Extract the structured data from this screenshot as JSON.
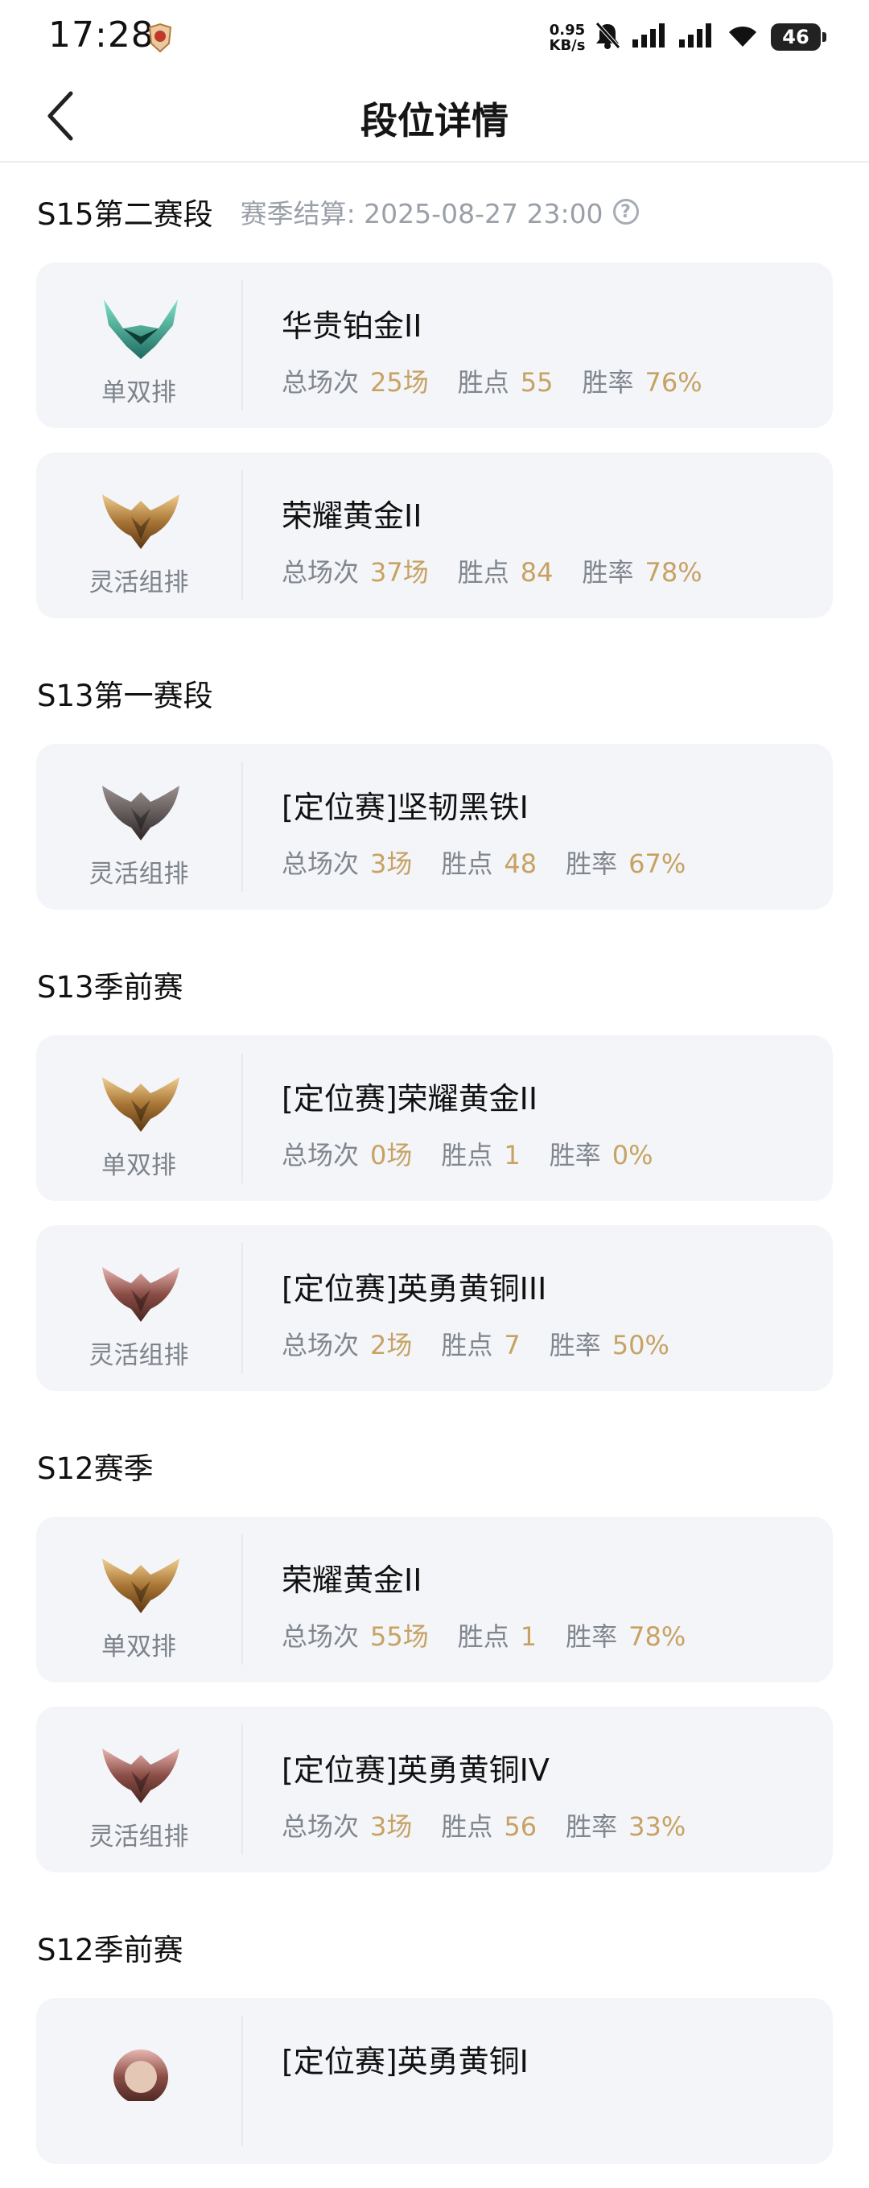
{
  "status_bar": {
    "time": "17:28",
    "net_value": "0.95",
    "net_unit": "KB/s",
    "battery": "46"
  },
  "header": {
    "title": "段位详情"
  },
  "labels": {
    "games": "总场次",
    "points": "胜点",
    "winrate": "胜率"
  },
  "colors": {
    "accent": "#c7a262",
    "card_bg": "#f3f5f9",
    "muted": "#80868e"
  },
  "seasons": [
    {
      "name": "S15第二赛段",
      "settlement": "赛季结算: 2025-08-27 23:00",
      "entries": [
        {
          "emblem": "platinum",
          "queue": "单双排",
          "rank": "华贵铂金II",
          "games": "25场",
          "points": "55",
          "winrate": "76%"
        },
        {
          "emblem": "gold",
          "queue": "灵活组排",
          "rank": "荣耀黄金II",
          "games": "37场",
          "points": "84",
          "winrate": "78%"
        }
      ]
    },
    {
      "name": "S13第一赛段",
      "entries": [
        {
          "emblem": "iron",
          "queue": "灵活组排",
          "rank": "[定位赛]坚韧黑铁I",
          "games": "3场",
          "points": "48",
          "winrate": "67%"
        }
      ]
    },
    {
      "name": "S13季前赛",
      "entries": [
        {
          "emblem": "gold",
          "queue": "单双排",
          "rank": "[定位赛]荣耀黄金II",
          "games": "0场",
          "points": "1",
          "winrate": "0%"
        },
        {
          "emblem": "bronze",
          "queue": "灵活组排",
          "rank": "[定位赛]英勇黄铜III",
          "games": "2场",
          "points": "7",
          "winrate": "50%"
        }
      ]
    },
    {
      "name": "S12赛季",
      "entries": [
        {
          "emblem": "gold",
          "queue": "单双排",
          "rank": "荣耀黄金II",
          "games": "55场",
          "points": "1",
          "winrate": "78%"
        },
        {
          "emblem": "bronze",
          "queue": "灵活组排",
          "rank": "[定位赛]英勇黄铜IV",
          "games": "3场",
          "points": "56",
          "winrate": "33%"
        }
      ]
    },
    {
      "name": "S12季前赛",
      "entries": [
        {
          "emblem": "bronze-crest",
          "queue": "",
          "rank": "[定位赛]英勇黄铜I",
          "games": "",
          "points": "",
          "winrate": ""
        }
      ]
    }
  ]
}
